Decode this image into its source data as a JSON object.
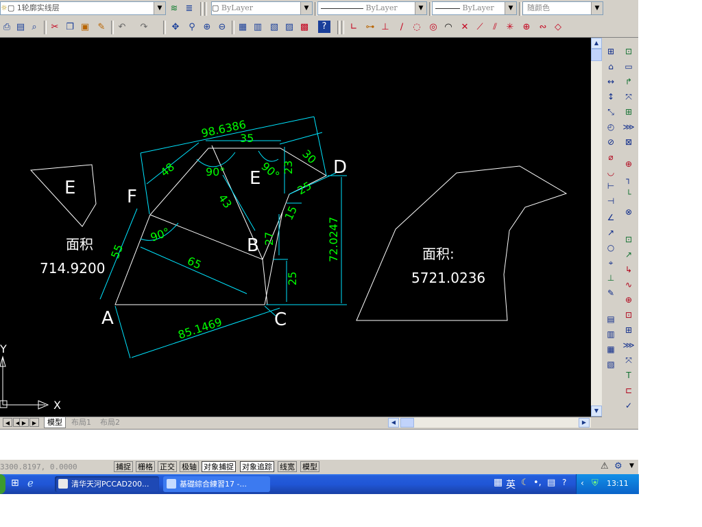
{
  "toolbar": {
    "layer_combo": "1轮廓实线层",
    "color_combo": "ByLayer",
    "linetype_combo": "ByLayer",
    "lineweight_combo": "ByLayer",
    "plotstyle_combo": "随颜色"
  },
  "drawing": {
    "point_labels": {
      "A": "A",
      "B": "B",
      "C": "C",
      "D": "D",
      "E": "E",
      "F": "F"
    },
    "dims": {
      "d98": "98.6386",
      "d35": "35",
      "d30": "30",
      "d48": "48",
      "d90a": "90°",
      "d90b": "90°",
      "d90c": "90°",
      "d23": "23",
      "d25a": "25",
      "d43": "43",
      "d15": "15",
      "d27": "27",
      "d72": "72.0247",
      "d55": "55",
      "d65": "65",
      "d25b": "25",
      "d85": "85.1469"
    },
    "shape_e_label": "E",
    "area_left_label": "面积",
    "area_left_value": "714.9200",
    "area_right_label": "面积:",
    "area_right_value": "5721.0236",
    "ucs_x": "X",
    "ucs_y": "Y"
  },
  "layout_tabs": [
    "模型",
    "布局1",
    "布局2"
  ],
  "status": {
    "coords": "3300.8197,  0.0000",
    "toggles": [
      "捕捉",
      "栅格",
      "正交",
      "极轴",
      "对象捕捉",
      "对象追踪",
      "线宽",
      "模型"
    ]
  },
  "taskbar": {
    "items": [
      "清华天河PCCAD200...",
      "基礎綜合練習17 -..."
    ],
    "ime": "英",
    "clock": "13:11"
  },
  "colors": {
    "canvas_bg": "#000000",
    "geometry": "#ffffff",
    "dimension_lines": "#00e5ff",
    "dimension_text": "#00ff00"
  }
}
